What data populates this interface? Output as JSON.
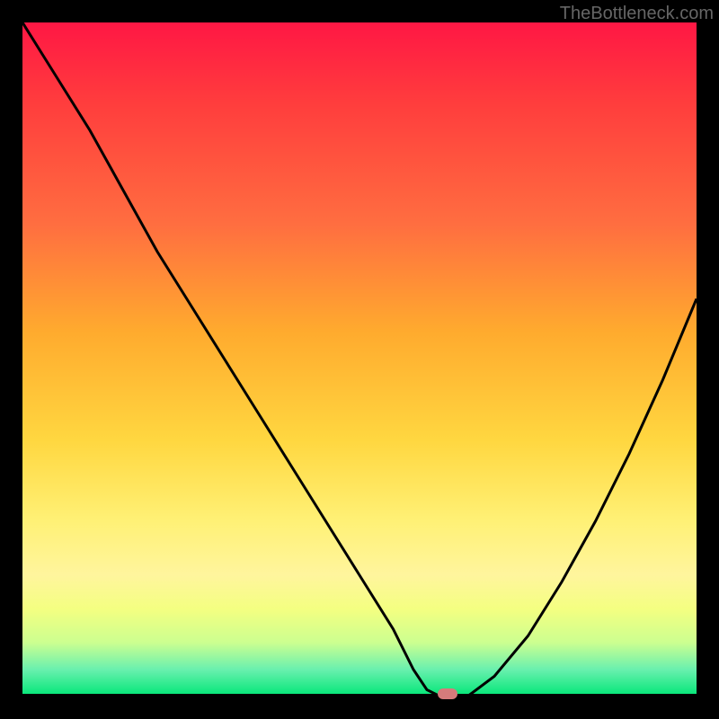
{
  "watermark": "TheBottleneck.com",
  "chart_data": {
    "type": "line",
    "title": "",
    "xlabel": "",
    "ylabel": "",
    "xlim": [
      0,
      100
    ],
    "ylim": [
      0,
      100
    ],
    "x": [
      0,
      5,
      10,
      15,
      20,
      25,
      30,
      35,
      40,
      45,
      50,
      55,
      58,
      60,
      62,
      64,
      66,
      70,
      75,
      80,
      85,
      90,
      95,
      100
    ],
    "y": [
      100,
      92,
      84,
      75,
      66,
      58,
      50,
      42,
      34,
      26,
      18,
      10,
      4,
      1,
      0,
      0,
      0,
      3,
      9,
      17,
      26,
      36,
      47,
      59
    ],
    "marker_x": 63,
    "marker_y": 0,
    "gradient_stops": [
      {
        "pos": 0,
        "color": "#ff1744"
      },
      {
        "pos": 12,
        "color": "#ff3d3d"
      },
      {
        "pos": 30,
        "color": "#ff6e40"
      },
      {
        "pos": 46,
        "color": "#ffab2e"
      },
      {
        "pos": 62,
        "color": "#ffd740"
      },
      {
        "pos": 74,
        "color": "#fff176"
      },
      {
        "pos": 82,
        "color": "#fff59d"
      },
      {
        "pos": 87,
        "color": "#f4ff81"
      },
      {
        "pos": 92,
        "color": "#ccff90"
      },
      {
        "pos": 96,
        "color": "#69f0ae"
      },
      {
        "pos": 100,
        "color": "#00e676"
      }
    ]
  }
}
